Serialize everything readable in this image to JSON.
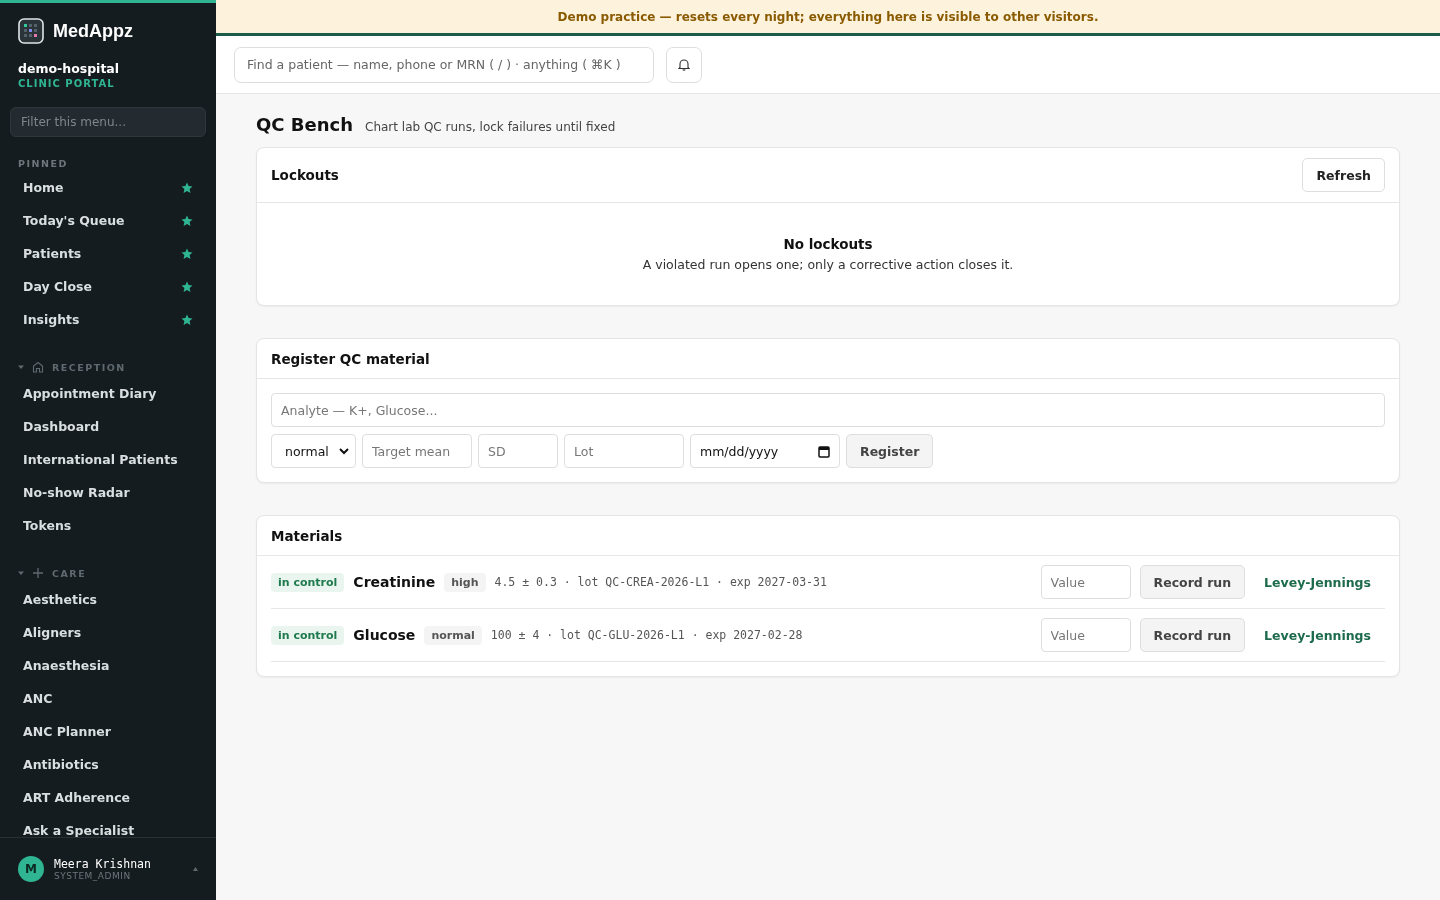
{
  "sidebar": {
    "brand": "MedAppz",
    "org": "demo-hospital",
    "portal": "CLINIC PORTAL",
    "filter_placeholder": "Filter this menu...",
    "pinned": {
      "title": "PINNED",
      "items": [
        {
          "label": "Home",
          "starred": true
        },
        {
          "label": "Today's Queue",
          "starred": true
        },
        {
          "label": "Patients",
          "starred": true
        },
        {
          "label": "Day Close",
          "starred": true
        },
        {
          "label": "Insights",
          "starred": true
        }
      ]
    },
    "groups": [
      {
        "title": "RECEPTION",
        "expanded": true,
        "items": [
          "Appointment Diary",
          "Dashboard",
          "International Patients",
          "No-show Radar",
          "Tokens"
        ]
      },
      {
        "title": "CARE",
        "expanded": true,
        "items": [
          "Aesthetics",
          "Aligners",
          "Anaesthesia",
          "ANC",
          "ANC Planner",
          "Antibiotics",
          "ART Adherence",
          "Ask a Specialist"
        ]
      }
    ],
    "user": {
      "initial": "M",
      "name": "Meera Krishnan",
      "role": "SYSTEM_ADMIN"
    }
  },
  "banner": "Demo practice — resets every night; everything here is visible to other visitors.",
  "topbar": {
    "search_placeholder": "Find a patient — name, phone or MRN ( / ) · anything ( ⌘K )"
  },
  "page": {
    "title": "QC Bench",
    "subtitle": "Chart lab QC runs, lock failures until fixed"
  },
  "lockouts": {
    "title": "Lockouts",
    "refresh": "Refresh",
    "empty_title": "No lockouts",
    "empty_text": "A violated run opens one; only a corrective action closes it."
  },
  "register": {
    "title": "Register QC material",
    "analyte_placeholder": "Analyte — K+, Glucose...",
    "level": "normal",
    "mean_placeholder": "Target mean",
    "sd_placeholder": "SD",
    "lot_placeholder": "Lot",
    "date_placeholder": "mm/dd/yyyy",
    "button": "Register"
  },
  "materials": {
    "title": "Materials",
    "rows": [
      {
        "status": "in control",
        "name": "Creatinine",
        "level": "high",
        "details": "4.5 ± 0.3 · lot QC-CREA-2026-L1 · exp 2027-03-31",
        "value_placeholder": "Value",
        "button": "Record run",
        "link": "Levey-Jennings"
      },
      {
        "status": "in control",
        "name": "Glucose",
        "level": "normal",
        "details": "100 ± 4 · lot QC-GLU-2026-L1 · exp 2027-02-28",
        "value_placeholder": "Value",
        "button": "Record run",
        "link": "Levey-Jennings"
      }
    ]
  }
}
